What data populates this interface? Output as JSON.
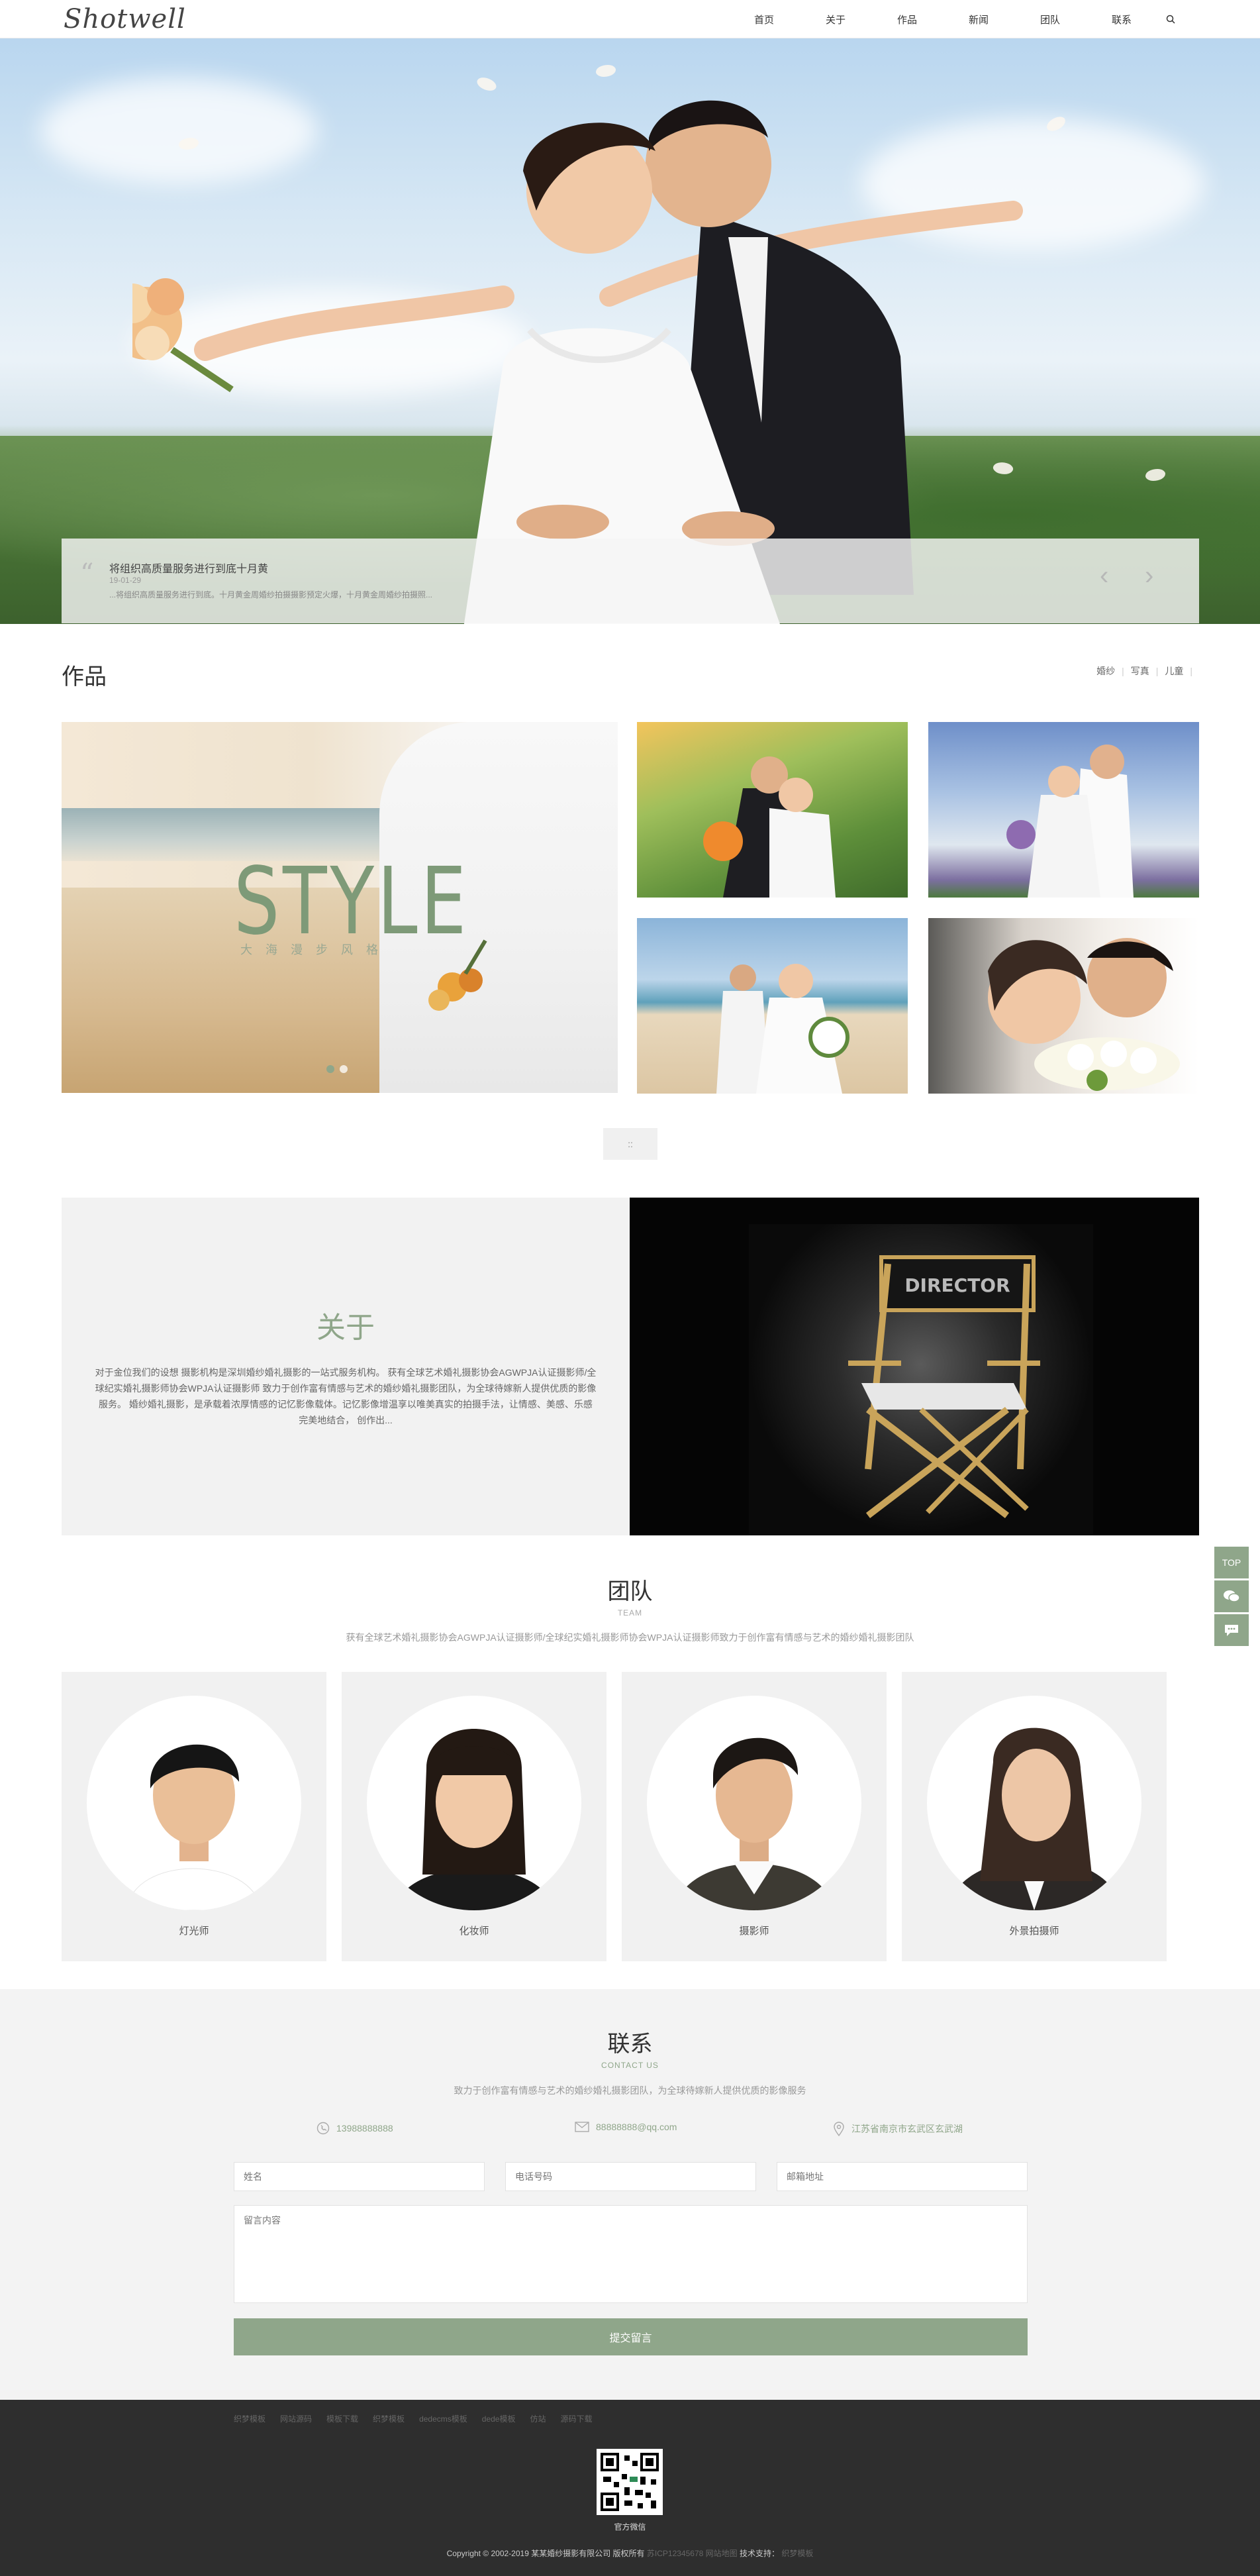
{
  "header": {
    "logo": "Shotwell",
    "nav": [
      "首页",
      "关于",
      "作品",
      "新闻",
      "团队",
      "联系"
    ]
  },
  "hero": {
    "title": "将组织高质量服务进行到底十月黄",
    "date": "19-01-29",
    "desc": "...将组织高质量服务进行到底。十月黄金周婚纱拍摄摄影预定火爆，十月黄金周婚纱拍摄照..."
  },
  "works": {
    "title": "作品",
    "filters": [
      "婚纱",
      "写真",
      "儿童"
    ],
    "banner_text": "STYLE",
    "banner_sub": "大海漫步风格",
    "more_label": "::"
  },
  "about": {
    "title": "关于",
    "text": "对于金位我们的设想 摄影机构是深圳婚纱婚礼摄影的一站式服务机构。 获有全球艺术婚礼摄影协会AGWPJA认证摄影师/全球纪实婚礼摄影师协会WPJA认证摄影师 致力于创作富有情感与艺术的婚纱婚礼摄影团队，为全球待嫁新人提供优质的影像服务。 婚纱婚礼摄影，是承载着浓厚情感的记忆影像载体。记忆影像增温享以唯美真实的拍摄手法，让情感、美感、乐感完美地结合，  创作出..."
  },
  "side_tools": {
    "top_label": "TOP"
  },
  "team": {
    "title": "团队",
    "subtitle": "TEAM",
    "desc": "获有全球艺术婚礼摄影协会AGWPJA认证摄影师/全球纪实婚礼摄影师协会WPJA认证摄影师致力于创作富有情感与艺术的婚纱婚礼摄影团队",
    "members": [
      {
        "name": "灯光师"
      },
      {
        "name": "化妆师"
      },
      {
        "name": "摄影师"
      },
      {
        "name": "外景拍摄师"
      }
    ]
  },
  "contact": {
    "title": "联系",
    "subtitle": "CONTACT US",
    "desc": "致力于创作富有情感与艺术的婚纱婚礼摄影团队，为全球待嫁新人提供优质的影像服务",
    "phone": "13988888888",
    "email": "88888888@qq.com",
    "address": "江苏省南京市玄武区玄武湖",
    "name_placeholder": "姓名",
    "tel_placeholder": "电话号码",
    "mail_placeholder": "邮箱地址",
    "message_placeholder": "留言内容",
    "submit_label": "提交留言"
  },
  "footer": {
    "links": [
      "织梦模板",
      "网站源码",
      "模板下载",
      "织梦模板",
      "dedecms模板",
      "dede模板",
      "仿站",
      "源码下载"
    ],
    "qr_label": "官方微信",
    "copyright": "Copyright © 2002-2019 某某婚纱摄影有限公司 版权所有",
    "icp": "苏ICP12345678",
    "sitemap": "网站地图",
    "tech_label": "技术支持：",
    "tech_value": "织梦模板"
  }
}
